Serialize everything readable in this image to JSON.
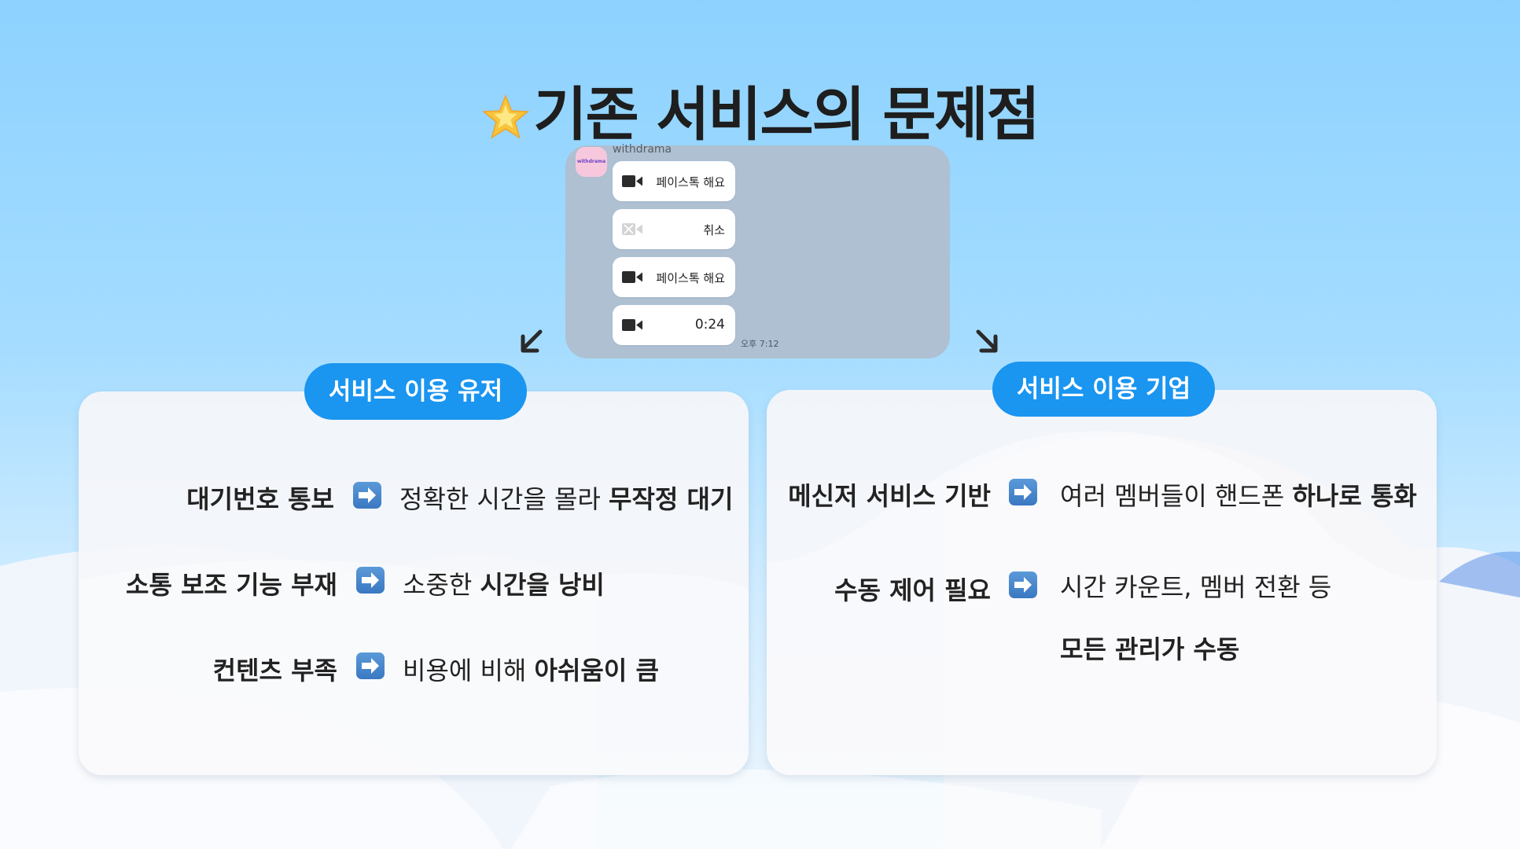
{
  "title": "기존 서비스의 문제점",
  "chat": {
    "sender": "withdrama",
    "avatar_text": "withdrama",
    "bubbles": [
      {
        "text": "페이스톡 해요",
        "icon": "video-camera-icon"
      },
      {
        "text": "취소",
        "icon": "video-camera-off-icon"
      },
      {
        "text": "페이스톡 해요",
        "icon": "video-camera-icon"
      },
      {
        "text": "0:24",
        "icon": "video-camera-icon"
      }
    ],
    "time": "오후 7:12"
  },
  "users": {
    "label": "서비스 이용 유저",
    "rows": [
      {
        "problem": "대기번호 통보",
        "result_plain": "정확한 시간을 몰라 ",
        "result_bold": "무작정 대기"
      },
      {
        "problem": "소통 보조 기능 부재",
        "result_plain": "소중한 ",
        "result_bold": "시간을 낭비"
      },
      {
        "problem": "컨텐츠 부족",
        "result_plain": "비용에 비해 ",
        "result_bold": "아쉬움이 큼"
      }
    ]
  },
  "companies": {
    "label": "서비스 이용 기업",
    "rows": [
      {
        "problem": "메신저 서비스 기반",
        "result_plain": "여러 멤버들이 핸드폰 ",
        "result_bold": "하나로 통화"
      },
      {
        "problem": "수동 제어 필요",
        "result_plain": "시간 카운트, 멤버 전환 등",
        "result_bold": "모든 관리가 수동"
      }
    ]
  },
  "colors": {
    "accent": "#1a95f0",
    "title": "#1e1e1e",
    "chat_bg": "#aec0d2"
  }
}
